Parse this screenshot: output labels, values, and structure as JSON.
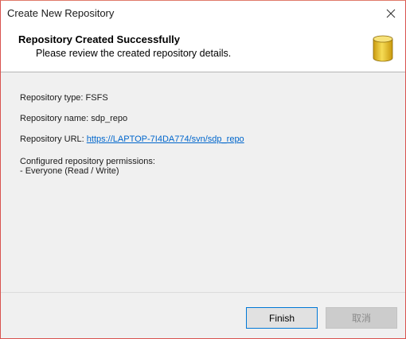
{
  "window": {
    "title": "Create New Repository"
  },
  "header": {
    "title": "Repository Created Successfully",
    "subtitle": "Please review the created repository details."
  },
  "details": {
    "type_line": "Repository type: FSFS",
    "name_line": "Repository name: sdp_repo",
    "url_label": "Repository URL: ",
    "url_value": "https://LAPTOP-7I4DA774/svn/sdp_repo",
    "permissions_label": "Configured repository permissions:",
    "permissions_value": "- Everyone (Read / Write)"
  },
  "buttons": {
    "finish_label": "Finish",
    "cancel_label": "取消"
  },
  "colors": {
    "accent": "#0078d7",
    "link": "#0066cc",
    "icon_gold": "#e8c22a"
  },
  "icons": {
    "close": "close-icon",
    "repository": "database-icon"
  }
}
